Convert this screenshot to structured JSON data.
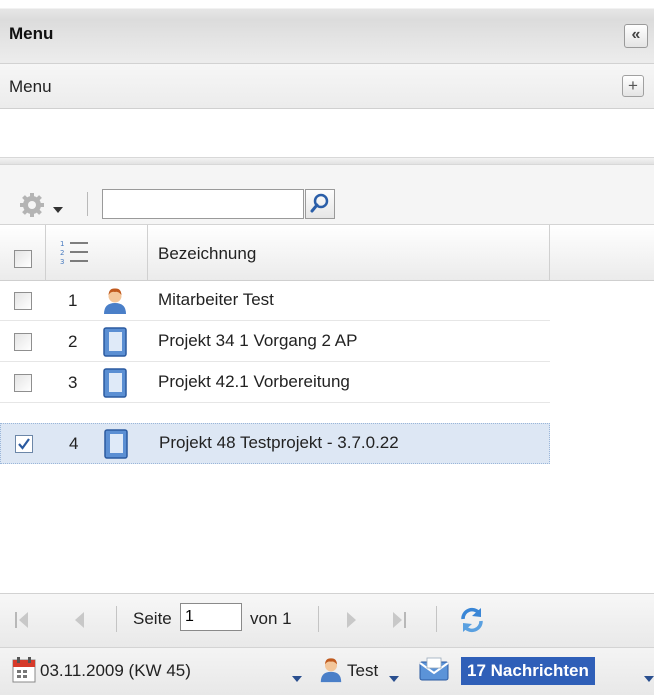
{
  "header": {
    "title": "Menu",
    "collapse_symbol": "«"
  },
  "menu_row": {
    "label": "Menu",
    "expand_symbol": "+"
  },
  "toolbar": {
    "search_placeholder": ""
  },
  "grid": {
    "column_header": "Bezeichnung",
    "rows": [
      {
        "num": "1",
        "icon": "user-icon",
        "label": "Mitarbeiter Test",
        "checked": false
      },
      {
        "num": "2",
        "icon": "book-icon",
        "label": "Projekt 34 1 Vorgang 2 AP",
        "checked": false
      },
      {
        "num": "3",
        "icon": "book-icon",
        "label": "Projekt 42.1 Vorbereitung",
        "checked": false
      },
      {
        "num": "4",
        "icon": "book-icon",
        "label": "Projekt 48 Testprojekt - 3.7.0.22",
        "checked": true
      }
    ]
  },
  "pager": {
    "page_label": "Seite",
    "page_value": "1",
    "total_label": "von 1"
  },
  "status": {
    "date": "03.11.2009 (KW 45)",
    "user": "Test",
    "messages": "17 Nachrichten"
  },
  "colors": {
    "selection": "#dde7f4",
    "badge": "#2f5fb8"
  }
}
